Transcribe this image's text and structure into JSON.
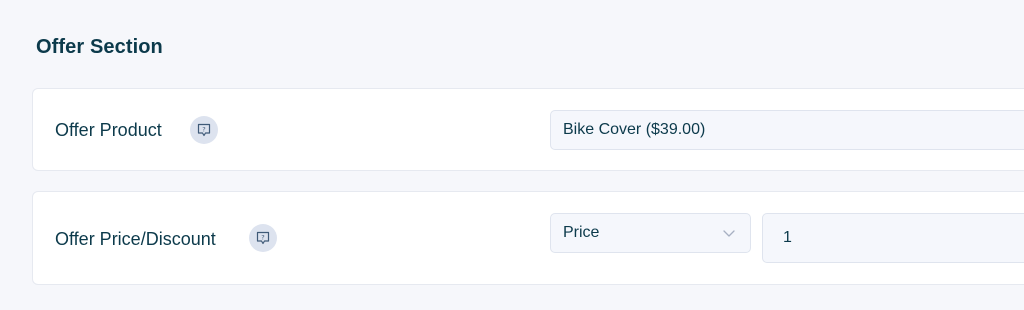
{
  "section": {
    "title": "Offer Section"
  },
  "offer_product": {
    "label": "Offer Product",
    "help_icon": "help-tooltip-icon",
    "selected_value": "Bike Cover ($39.00)"
  },
  "offer_price": {
    "label": "Offer Price/Discount",
    "help_icon": "help-tooltip-icon",
    "type_selected": "Price",
    "value": "1"
  },
  "colors": {
    "background": "#f6f7fb",
    "card": "#ffffff",
    "text": "#0c3a4b",
    "field_bg": "#f5f7fc",
    "icon_bg": "#dde3ef"
  }
}
